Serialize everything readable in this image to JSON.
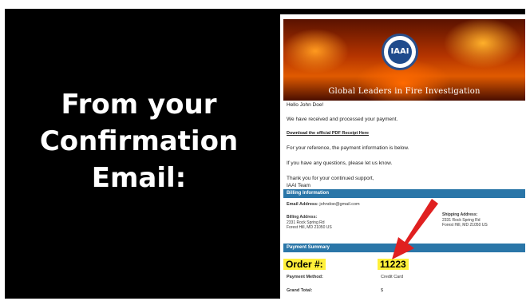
{
  "slide": {
    "headline_lines": [
      "From your",
      "Confirmation",
      "Email:"
    ]
  },
  "email": {
    "logo_text": "IAAI",
    "tagline": "Global Leaders in Fire Investigation",
    "greeting": "Hello John Doe!",
    "line_received": "We have received and processed your payment.",
    "link_receipt": "Download the official PDF Receipt Here",
    "line_reference": "For your reference, the payment information is below.",
    "line_questions": "If you have any questions, please let us know.",
    "line_thanks": "Thank you for your continued support,",
    "line_team": "IAAI Team",
    "billing_header": "Billing Information",
    "email_label": "Email Address:",
    "email_value": "johndoe@gmail.com",
    "billing_address_label": "Billing Address:",
    "billing_address_line1": "2331 Rock Spring Rd",
    "billing_address_line2": "Forest Hill, MD 21050 US",
    "shipping_address_label": "Shipping Address:",
    "shipping_address_line1": "2331 Rock Spring Rd",
    "shipping_address_line2": "Forest Hill, MD 21050 US",
    "payment_header": "Payment Summary",
    "order_label": "Order #:",
    "order_value": "11223",
    "payment_method_label": "Payment Method:",
    "payment_method_value": "Credit Card",
    "grand_total_label": "Grand Total:",
    "grand_total_value": "$"
  },
  "colors": {
    "section_bar": "#2a76a8",
    "highlight": "#fff03a",
    "arrow": "#e02020"
  }
}
